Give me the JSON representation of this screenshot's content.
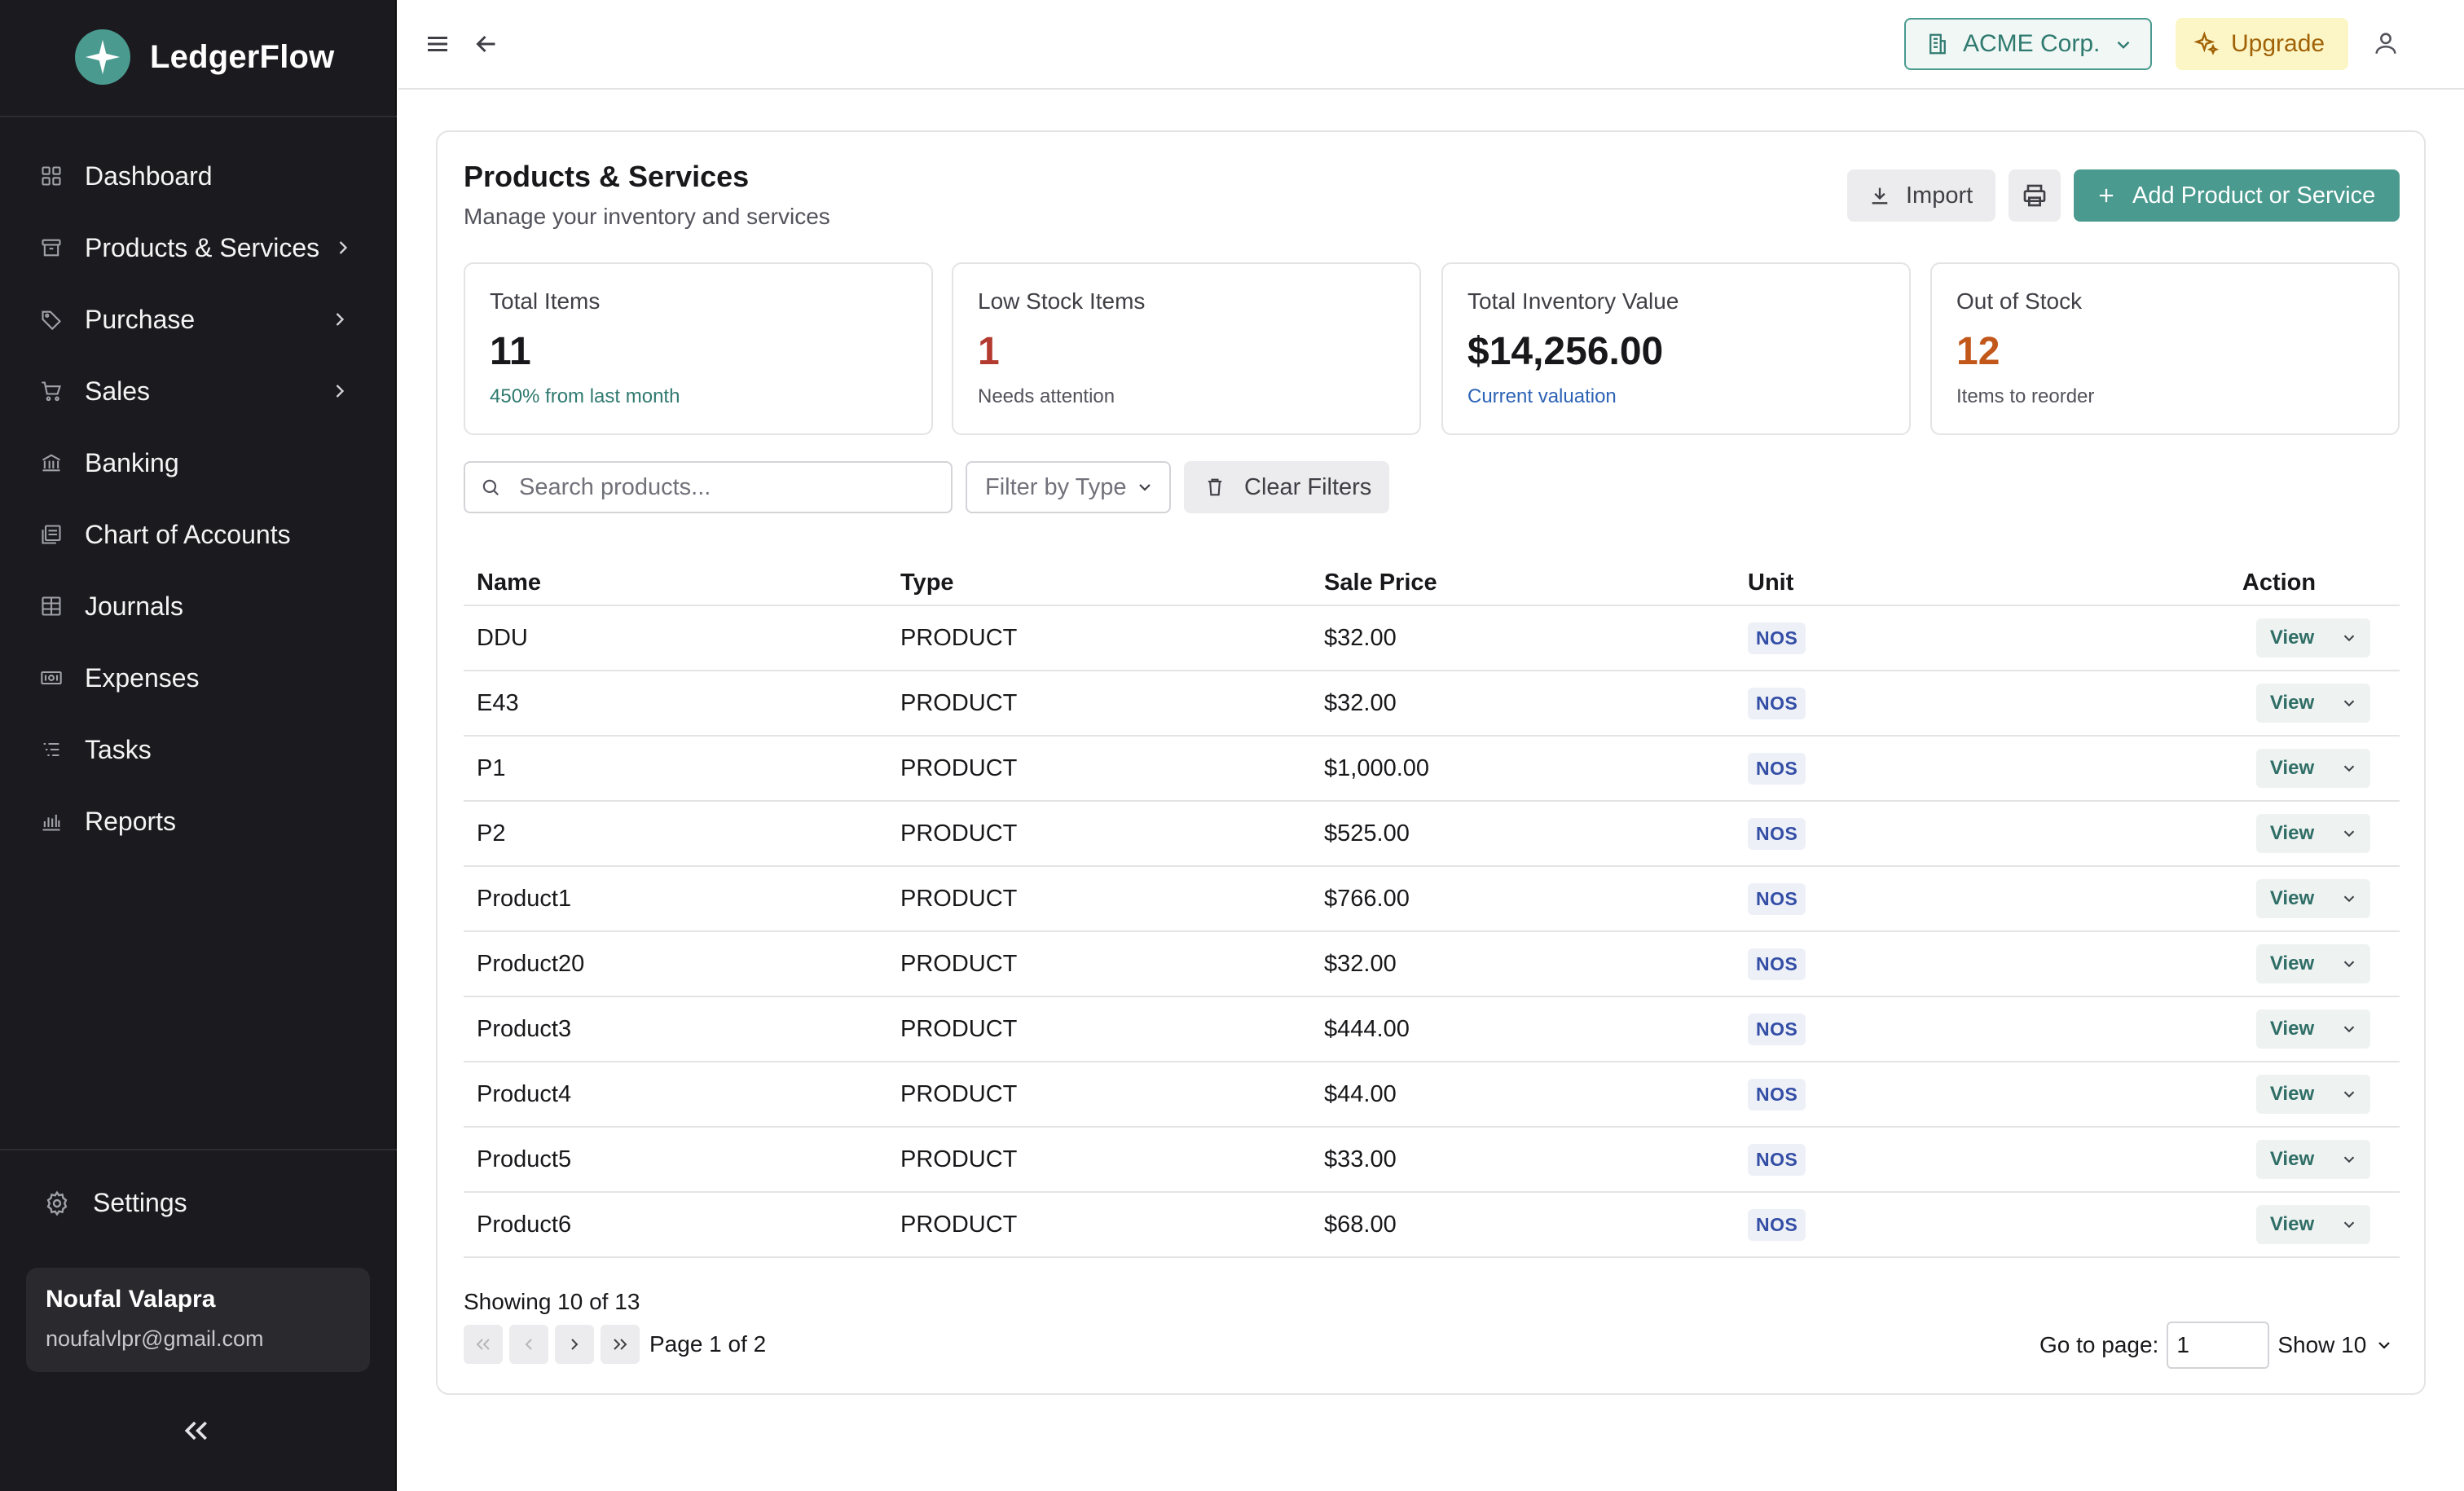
{
  "brand": {
    "name": "LedgerFlow",
    "logo_color": "#4a9a8f"
  },
  "sidebar": {
    "items": [
      {
        "label": "Dashboard",
        "icon": "grid-icon",
        "has_submenu": false
      },
      {
        "label": "Products & Services",
        "icon": "box-icon",
        "has_submenu": true
      },
      {
        "label": "Purchase",
        "icon": "tag-icon",
        "has_submenu": true
      },
      {
        "label": "Sales",
        "icon": "cart-icon",
        "has_submenu": true
      },
      {
        "label": "Banking",
        "icon": "bank-icon",
        "has_submenu": false
      },
      {
        "label": "Chart of Accounts",
        "icon": "ledger-icon",
        "has_submenu": false
      },
      {
        "label": "Journals",
        "icon": "table-icon",
        "has_submenu": false
      },
      {
        "label": "Expenses",
        "icon": "cash-icon",
        "has_submenu": false
      },
      {
        "label": "Tasks",
        "icon": "list-icon",
        "has_submenu": false
      },
      {
        "label": "Reports",
        "icon": "bar-chart-icon",
        "has_submenu": false
      }
    ],
    "settings_label": "Settings",
    "user": {
      "name": "Noufal Valapra",
      "email": "noufalvlpr@gmail.com"
    }
  },
  "topbar": {
    "company": "ACME Corp.",
    "upgrade_label": "Upgrade"
  },
  "page": {
    "title": "Products & Services",
    "subtitle": "Manage your inventory and services",
    "import_label": "Import",
    "add_label": "Add Product or Service"
  },
  "stats": [
    {
      "label": "Total Items",
      "value": "11",
      "note": "450% from last month",
      "value_color": "#18181b",
      "note_color": "#2f7a6f"
    },
    {
      "label": "Low Stock Items",
      "value": "1",
      "note": "Needs attention",
      "value_color": "#b23a2e",
      "note_color": "#52525b"
    },
    {
      "label": "Total Inventory Value",
      "value": "$14,256.00",
      "note": "Current valuation",
      "value_color": "#18181b",
      "note_color": "#2d63b5"
    },
    {
      "label": "Out of Stock",
      "value": "12",
      "note": "Items to reorder",
      "value_color": "#c2571a",
      "note_color": "#52525b"
    }
  ],
  "filters": {
    "search_placeholder": "Search products...",
    "type_label": "Filter by Type",
    "clear_label": "Clear Filters"
  },
  "table": {
    "headers": {
      "name": "Name",
      "type": "Type",
      "price": "Sale Price",
      "unit": "Unit",
      "action": "Action"
    },
    "view_label": "View",
    "rows": [
      {
        "name": "DDU",
        "type": "PRODUCT",
        "price": "$32.00",
        "unit": "NOS"
      },
      {
        "name": "E43",
        "type": "PRODUCT",
        "price": "$32.00",
        "unit": "NOS"
      },
      {
        "name": "P1",
        "type": "PRODUCT",
        "price": "$1,000.00",
        "unit": "NOS"
      },
      {
        "name": "P2",
        "type": "PRODUCT",
        "price": "$525.00",
        "unit": "NOS"
      },
      {
        "name": "Product1",
        "type": "PRODUCT",
        "price": "$766.00",
        "unit": "NOS"
      },
      {
        "name": "Product20",
        "type": "PRODUCT",
        "price": "$32.00",
        "unit": "NOS"
      },
      {
        "name": "Product3",
        "type": "PRODUCT",
        "price": "$444.00",
        "unit": "NOS"
      },
      {
        "name": "Product4",
        "type": "PRODUCT",
        "price": "$44.00",
        "unit": "NOS"
      },
      {
        "name": "Product5",
        "type": "PRODUCT",
        "price": "$33.00",
        "unit": "NOS"
      },
      {
        "name": "Product6",
        "type": "PRODUCT",
        "price": "$68.00",
        "unit": "NOS"
      }
    ]
  },
  "pagination": {
    "showing": "Showing 10 of 13",
    "page_of": "Page 1 of 2",
    "goto_label": "Go to page:",
    "goto_value": "1",
    "show_label": "Show 10"
  }
}
